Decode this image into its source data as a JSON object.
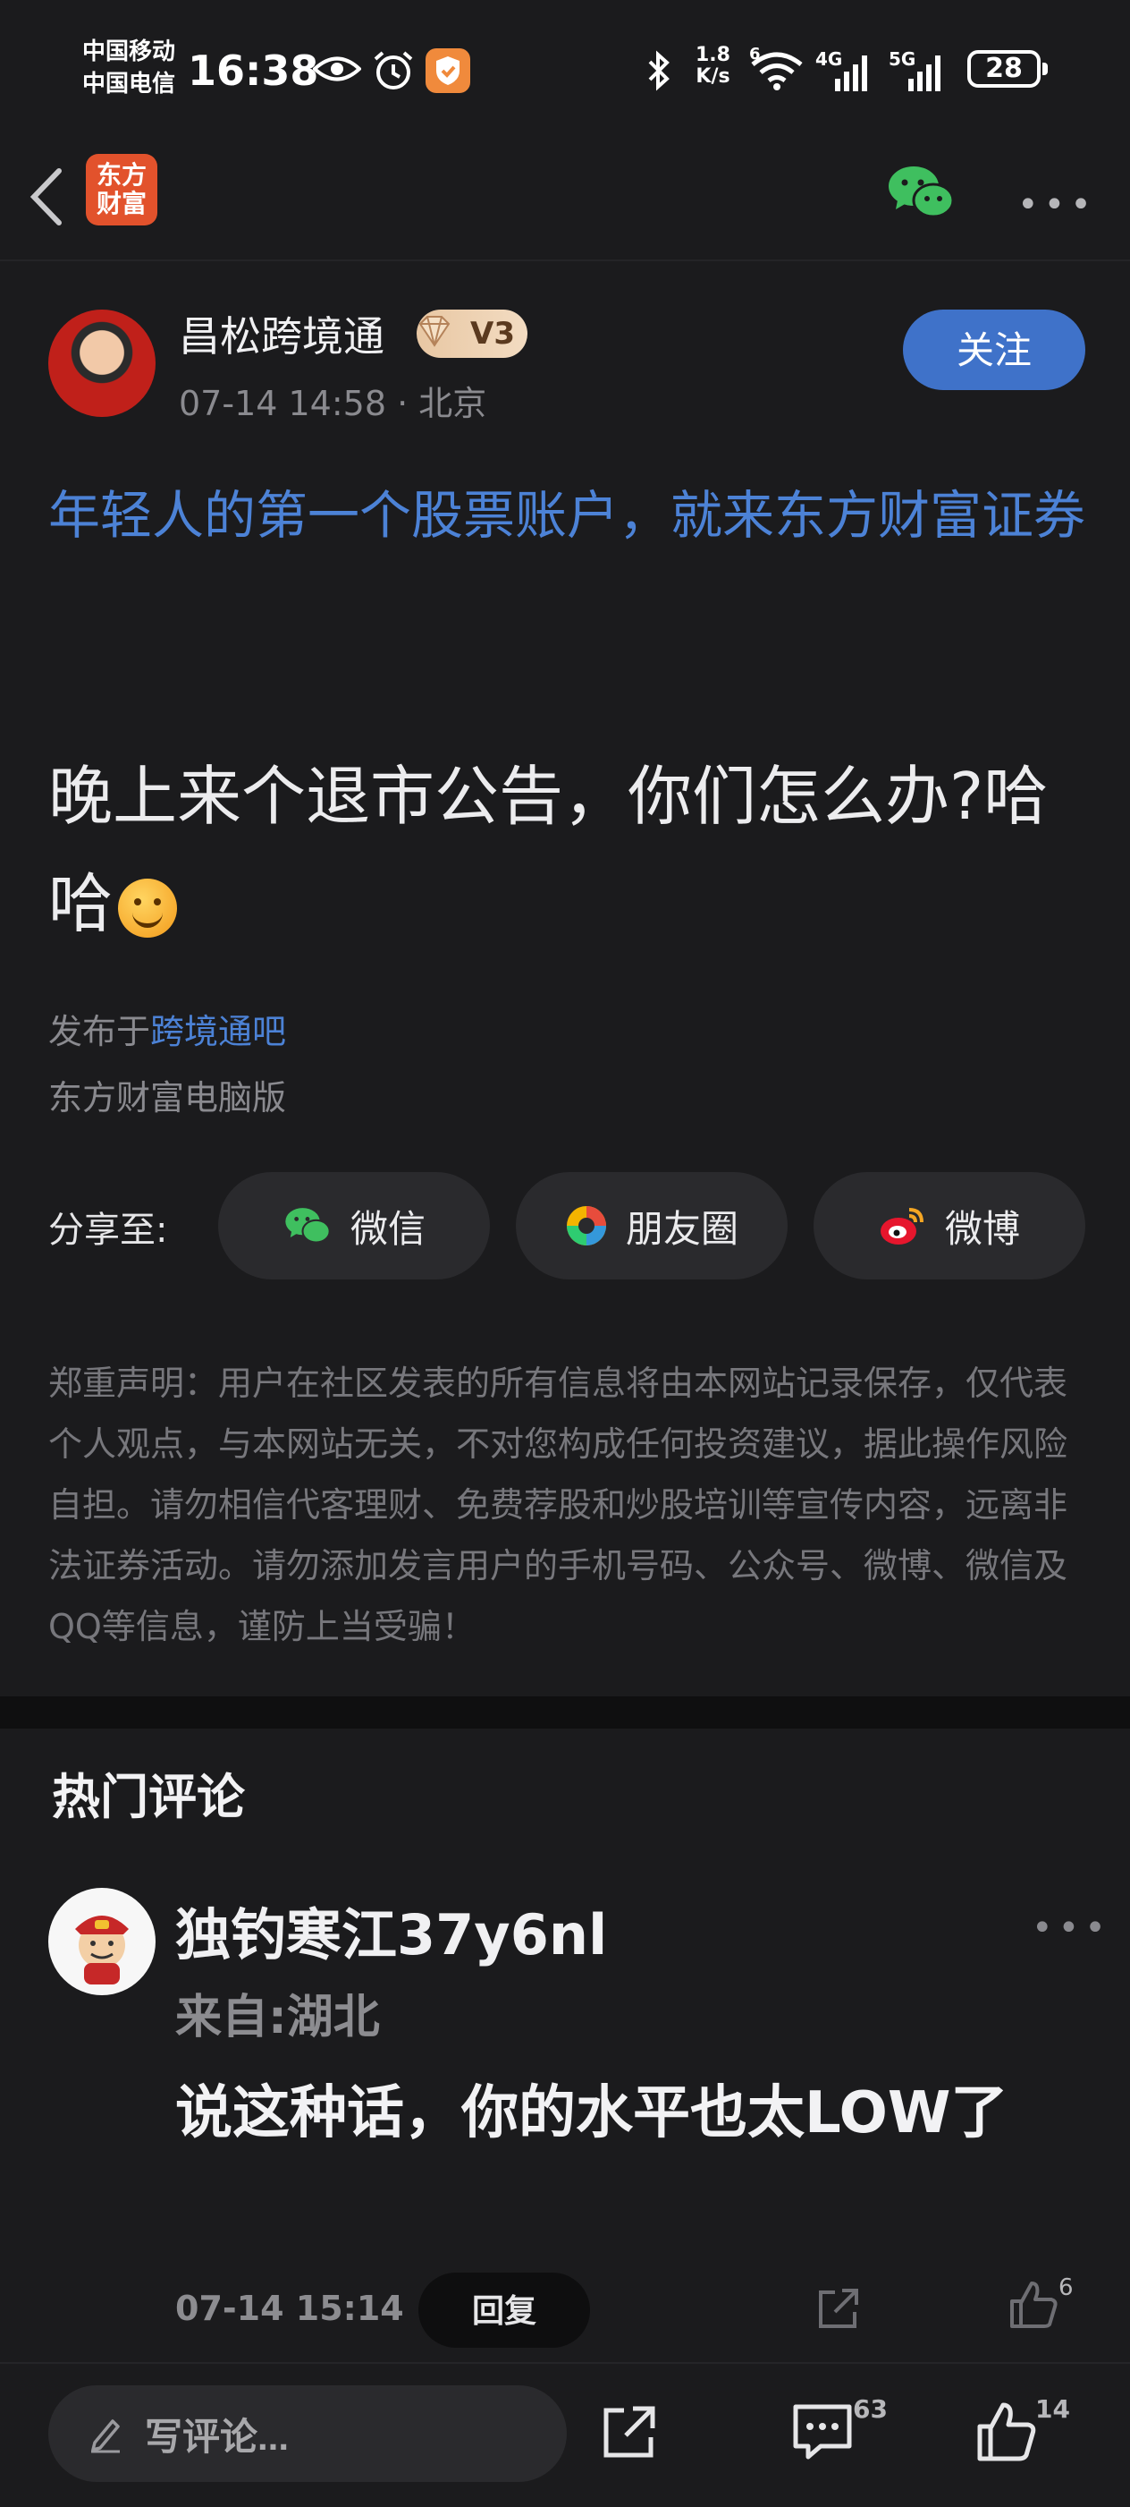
{
  "status_bar": {
    "carrier_1": "中国移动",
    "carrier_2": "中国电信",
    "time": "16:38",
    "speed_value": "1.8",
    "speed_unit": "K/s",
    "wifi_label": "6",
    "net_1": "4G",
    "net_2": "5G",
    "battery": "28"
  },
  "nav": {
    "logo_line1": "东方",
    "logo_line2": "财富",
    "back_icon": "chevron-left-icon",
    "share_icon": "wechat-icon",
    "more_icon": "more-dots-icon"
  },
  "post": {
    "author": "昌松跨境通",
    "badge": "V3",
    "time": "07-14 14:58",
    "location": "北京",
    "follow_label": "关注",
    "headline": "年轻人的第一个股票账户，就来东方财富证券",
    "body": "晚上来个退市公告，你们怎么办?哈哈",
    "published_prefix": "发布于",
    "published_bar": "跨境通吧",
    "client": "东方财富电脑版"
  },
  "share": {
    "label": "分享至:",
    "options": [
      {
        "label": "微信",
        "icon": "wechat-icon"
      },
      {
        "label": "朋友圈",
        "icon": "moments-icon"
      },
      {
        "label": "微博",
        "icon": "weibo-icon"
      }
    ]
  },
  "disclaimer": "郑重声明：用户在社区发表的所有信息将由本网站记录保存，仅代表个人观点，与本网站无关，不对您构成任何投资建议，据此操作风险自担。请勿相信代客理财、免费荐股和炒股培训等宣传内容，远离非法证券活动。请勿添加发言用户的手机号码、公众号、微博、微信及QQ等信息，谨防上当受骗！",
  "comments": {
    "section_title": "热门评论",
    "items": [
      {
        "user": "独钓寒江37y6nl",
        "from": "来自:湖北",
        "text": "说这种话，你的水平也太LOW了",
        "time": "07-14 15:14",
        "reply_label": "回复",
        "likes": "6"
      }
    ]
  },
  "bottom_bar": {
    "write_placeholder": "写评论...",
    "comment_count": "63",
    "like_count": "14"
  },
  "colors": {
    "background": "#1b1b1d",
    "link_blue": "#4c82d6",
    "follow_button": "#3f72c9",
    "logo_orange": "#e2522c"
  }
}
